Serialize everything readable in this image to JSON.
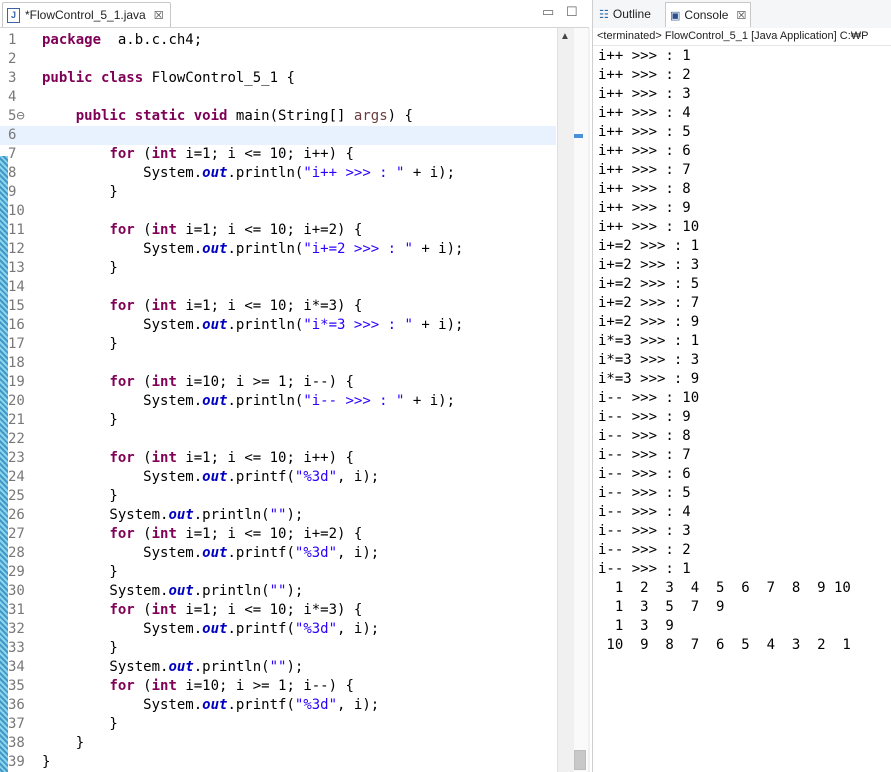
{
  "editor": {
    "tab_title": "*FlowControl_5_1.java",
    "file_icon_glyph": "J",
    "close_glyph": "☒",
    "minimize_glyph": "▭",
    "maximize_glyph": "☐",
    "scroll_up_glyph": "▲",
    "current_line": 6,
    "lines": [
      {
        "n": "1",
        "t": [
          [
            "k",
            "package"
          ],
          [
            "",
            "  a.b.c.ch4;"
          ]
        ]
      },
      {
        "n": "2",
        "t": []
      },
      {
        "n": "3",
        "t": [
          [
            "k",
            "public"
          ],
          [
            "",
            ""
          ],
          [
            "k",
            " class"
          ],
          [
            "",
            " FlowControl_5_1 {"
          ]
        ]
      },
      {
        "n": "4",
        "t": []
      },
      {
        "n": "5⊖",
        "t": [
          [
            "",
            "    "
          ],
          [
            "k",
            "public"
          ],
          [
            "k",
            " static"
          ],
          [
            "k",
            " void"
          ],
          [
            "",
            " main(String[] "
          ],
          [
            "p",
            "args"
          ],
          [
            "",
            ") {"
          ]
        ]
      },
      {
        "n": "6",
        "t": [
          [
            "",
            "        "
          ]
        ]
      },
      {
        "n": "7",
        "t": [
          [
            "",
            "        "
          ],
          [
            "k",
            "for"
          ],
          [
            "",
            " ("
          ],
          [
            "k",
            "int"
          ],
          [
            "",
            " i=1; i <= 10; i++) {"
          ]
        ]
      },
      {
        "n": "8",
        "t": [
          [
            "",
            "            System."
          ],
          [
            "f",
            "out"
          ],
          [
            "",
            ".println("
          ],
          [
            "s",
            "\"i++ >>> : \""
          ],
          [
            "",
            " + i);"
          ]
        ]
      },
      {
        "n": "9",
        "t": [
          [
            "",
            "        }"
          ]
        ]
      },
      {
        "n": "10",
        "t": []
      },
      {
        "n": "11",
        "t": [
          [
            "",
            "        "
          ],
          [
            "k",
            "for"
          ],
          [
            "",
            " ("
          ],
          [
            "k",
            "int"
          ],
          [
            "",
            " i=1; i <= 10; i+=2) {"
          ]
        ]
      },
      {
        "n": "12",
        "t": [
          [
            "",
            "            System."
          ],
          [
            "f",
            "out"
          ],
          [
            "",
            ".println("
          ],
          [
            "s",
            "\"i+=2 >>> : \""
          ],
          [
            "",
            " + i);"
          ]
        ]
      },
      {
        "n": "13",
        "t": [
          [
            "",
            "        }"
          ]
        ]
      },
      {
        "n": "14",
        "t": []
      },
      {
        "n": "15",
        "t": [
          [
            "",
            "        "
          ],
          [
            "k",
            "for"
          ],
          [
            "",
            " ("
          ],
          [
            "k",
            "int"
          ],
          [
            "",
            " i=1; i <= 10; i*=3) {"
          ]
        ]
      },
      {
        "n": "16",
        "t": [
          [
            "",
            "            System."
          ],
          [
            "f",
            "out"
          ],
          [
            "",
            ".println("
          ],
          [
            "s",
            "\"i*=3 >>> : \""
          ],
          [
            "",
            " + i);"
          ]
        ]
      },
      {
        "n": "17",
        "t": [
          [
            "",
            "        }"
          ]
        ]
      },
      {
        "n": "18",
        "t": []
      },
      {
        "n": "19",
        "t": [
          [
            "",
            "        "
          ],
          [
            "k",
            "for"
          ],
          [
            "",
            " ("
          ],
          [
            "k",
            "int"
          ],
          [
            "",
            " i=10; i >= 1; i--) {"
          ]
        ]
      },
      {
        "n": "20",
        "t": [
          [
            "",
            "            System."
          ],
          [
            "f",
            "out"
          ],
          [
            "",
            ".println("
          ],
          [
            "s",
            "\"i-- >>> : \""
          ],
          [
            "",
            " + i);"
          ]
        ]
      },
      {
        "n": "21",
        "t": [
          [
            "",
            "        }"
          ]
        ]
      },
      {
        "n": "22",
        "t": []
      },
      {
        "n": "23",
        "t": [
          [
            "",
            "        "
          ],
          [
            "k",
            "for"
          ],
          [
            "",
            " ("
          ],
          [
            "k",
            "int"
          ],
          [
            "",
            " i=1; i <= 10; i++) {"
          ]
        ]
      },
      {
        "n": "24",
        "t": [
          [
            "",
            "            System."
          ],
          [
            "f",
            "out"
          ],
          [
            "",
            ".printf("
          ],
          [
            "s",
            "\"%3d\""
          ],
          [
            "",
            ", i);"
          ]
        ]
      },
      {
        "n": "25",
        "t": [
          [
            "",
            "        }"
          ]
        ]
      },
      {
        "n": "26",
        "t": [
          [
            "",
            "        System."
          ],
          [
            "f",
            "out"
          ],
          [
            "",
            ".println("
          ],
          [
            "s",
            "\"\""
          ],
          [
            "",
            ");"
          ]
        ]
      },
      {
        "n": "27",
        "t": [
          [
            "",
            "        "
          ],
          [
            "k",
            "for"
          ],
          [
            "",
            " ("
          ],
          [
            "k",
            "int"
          ],
          [
            "",
            " i=1; i <= 10; i+=2) {"
          ]
        ]
      },
      {
        "n": "28",
        "t": [
          [
            "",
            "            System."
          ],
          [
            "f",
            "out"
          ],
          [
            "",
            ".printf("
          ],
          [
            "s",
            "\"%3d\""
          ],
          [
            "",
            ", i);"
          ]
        ]
      },
      {
        "n": "29",
        "t": [
          [
            "",
            "        }"
          ]
        ]
      },
      {
        "n": "30",
        "t": [
          [
            "",
            "        System."
          ],
          [
            "f",
            "out"
          ],
          [
            "",
            ".println("
          ],
          [
            "s",
            "\"\""
          ],
          [
            "",
            ");"
          ]
        ]
      },
      {
        "n": "31",
        "t": [
          [
            "",
            "        "
          ],
          [
            "k",
            "for"
          ],
          [
            "",
            " ("
          ],
          [
            "k",
            "int"
          ],
          [
            "",
            " i=1; i <= 10; i*=3) {"
          ]
        ]
      },
      {
        "n": "32",
        "t": [
          [
            "",
            "            System."
          ],
          [
            "f",
            "out"
          ],
          [
            "",
            ".printf("
          ],
          [
            "s",
            "\"%3d\""
          ],
          [
            "",
            ", i);"
          ]
        ]
      },
      {
        "n": "33",
        "t": [
          [
            "",
            "        }"
          ]
        ]
      },
      {
        "n": "34",
        "t": [
          [
            "",
            "        System."
          ],
          [
            "f",
            "out"
          ],
          [
            "",
            ".println("
          ],
          [
            "s",
            "\"\""
          ],
          [
            "",
            ");"
          ]
        ]
      },
      {
        "n": "35",
        "t": [
          [
            "",
            "        "
          ],
          [
            "k",
            "for"
          ],
          [
            "",
            " ("
          ],
          [
            "k",
            "int"
          ],
          [
            "",
            " i=10; i >= 1; i--) {"
          ]
        ]
      },
      {
        "n": "36",
        "t": [
          [
            "",
            "            System."
          ],
          [
            "f",
            "out"
          ],
          [
            "",
            ".printf("
          ],
          [
            "s",
            "\"%3d\""
          ],
          [
            "",
            ", i);"
          ]
        ]
      },
      {
        "n": "37",
        "t": [
          [
            "",
            "        }"
          ]
        ]
      },
      {
        "n": "38",
        "t": [
          [
            "",
            "    }"
          ]
        ]
      },
      {
        "n": "39",
        "t": [
          [
            "",
            "}"
          ]
        ]
      }
    ]
  },
  "console": {
    "outline_tab": "Outline",
    "outline_icon_glyph": "☷",
    "console_tab": "Console",
    "console_icon_glyph": "▣",
    "close_glyph": "☒",
    "header": "<terminated> FlowControl_5_1 [Java Application] C:₩P",
    "output": [
      "i++ >>> : 1",
      "i++ >>> : 2",
      "i++ >>> : 3",
      "i++ >>> : 4",
      "i++ >>> : 5",
      "i++ >>> : 6",
      "i++ >>> : 7",
      "i++ >>> : 8",
      "i++ >>> : 9",
      "i++ >>> : 10",
      "i+=2 >>> : 1",
      "i+=2 >>> : 3",
      "i+=2 >>> : 5",
      "i+=2 >>> : 7",
      "i+=2 >>> : 9",
      "i*=3 >>> : 1",
      "i*=3 >>> : 3",
      "i*=3 >>> : 9",
      "i-- >>> : 10",
      "i-- >>> : 9",
      "i-- >>> : 8",
      "i-- >>> : 7",
      "i-- >>> : 6",
      "i-- >>> : 5",
      "i-- >>> : 4",
      "i-- >>> : 3",
      "i-- >>> : 2",
      "i-- >>> : 1",
      "  1  2  3  4  5  6  7  8  9 10",
      "  1  3  5  7  9",
      "  1  3  9",
      " 10  9  8  7  6  5  4  3  2  1"
    ]
  }
}
